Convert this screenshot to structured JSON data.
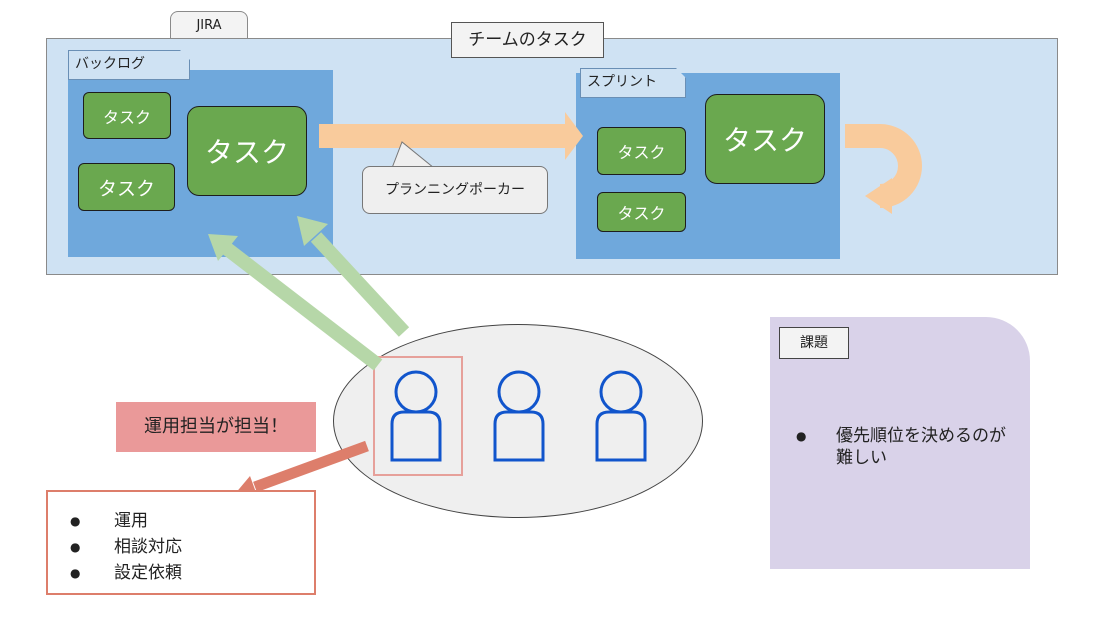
{
  "jira": {
    "tab_label": "JIRA",
    "title": "チームのタスク"
  },
  "backlog": {
    "label": "バックログ",
    "tasks": [
      "タスク",
      "タスク",
      "タスク"
    ]
  },
  "sprint": {
    "label": "スプリント",
    "tasks": [
      "タスク",
      "タスク",
      "タスク"
    ]
  },
  "planning": {
    "label": "プランニングポーカー"
  },
  "team": {
    "assign_label": "運用担当が担当！",
    "duties": [
      "運用",
      "相談対応",
      "設定依頼"
    ]
  },
  "issues": {
    "title": "課題",
    "items": [
      "優先順位を決めるのが難しい"
    ]
  },
  "colors": {
    "jira_bg": "#cfe2f3",
    "panel_blue": "#6fa8dc",
    "task_green": "#6aa84f",
    "flow_arrow": "#f9cb9c",
    "backlog_arrow": "#b6d7a8",
    "assign_arrow": "#dd7e6b",
    "person_blue": "#1155cc",
    "issue_panel": "#d9d2e9",
    "assign_label_bg": "#ea9999"
  }
}
